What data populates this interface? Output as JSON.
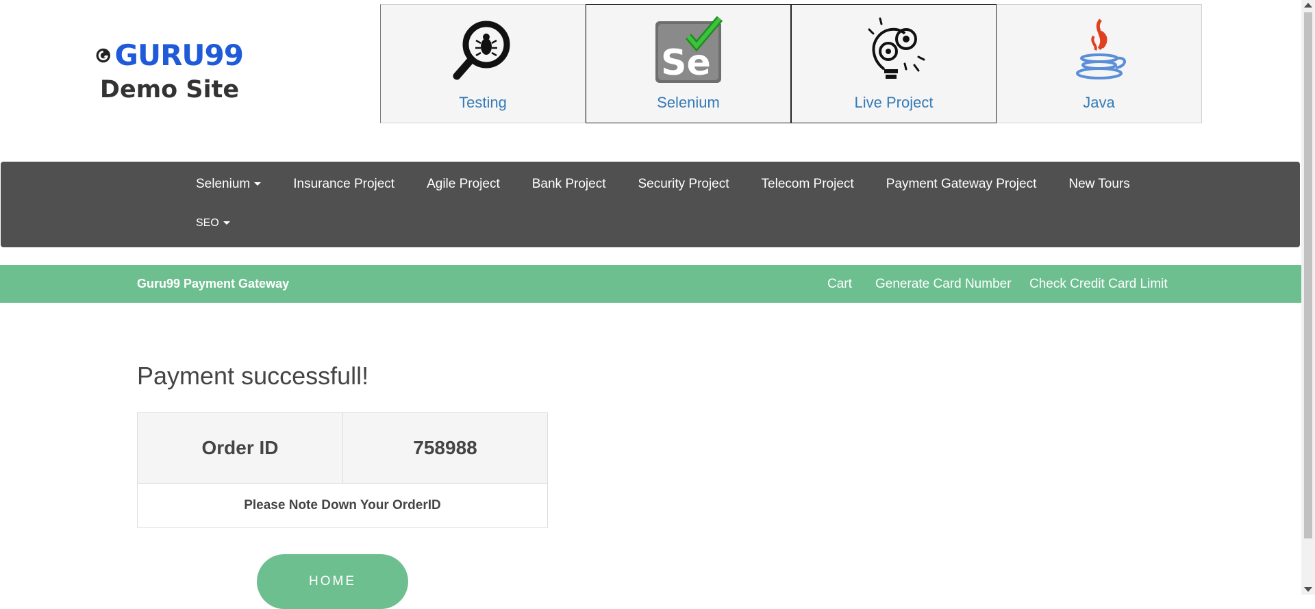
{
  "brand": {
    "logo_text": "GURU99",
    "subtitle": "Demo Site"
  },
  "tiles": [
    {
      "label": "Testing",
      "icon": "bug-magnifier-icon"
    },
    {
      "label": "Selenium",
      "icon": "selenium-icon"
    },
    {
      "label": "Live Project",
      "icon": "lightbulb-gears-icon"
    },
    {
      "label": "Java",
      "icon": "java-icon"
    }
  ],
  "nav": {
    "items": [
      "Selenium",
      "Insurance Project",
      "Agile Project",
      "Bank Project",
      "Security Project",
      "Telecom Project",
      "Payment Gateway Project",
      "New Tours"
    ],
    "row2": [
      "SEO"
    ]
  },
  "green_bar": {
    "brand": "Guru99 Payment Gateway",
    "links": [
      "Cart",
      "Generate Card Number",
      "Check Credit Card Limit"
    ]
  },
  "main": {
    "heading": "Payment successfull!",
    "order_label": "Order ID",
    "order_id": "758988",
    "note": "Please Note Down Your OrderID",
    "home_button": "HOME"
  },
  "colors": {
    "green": "#6dbf90",
    "nav": "#505050",
    "link": "#337ab7",
    "logo": "#1f5bd8"
  }
}
